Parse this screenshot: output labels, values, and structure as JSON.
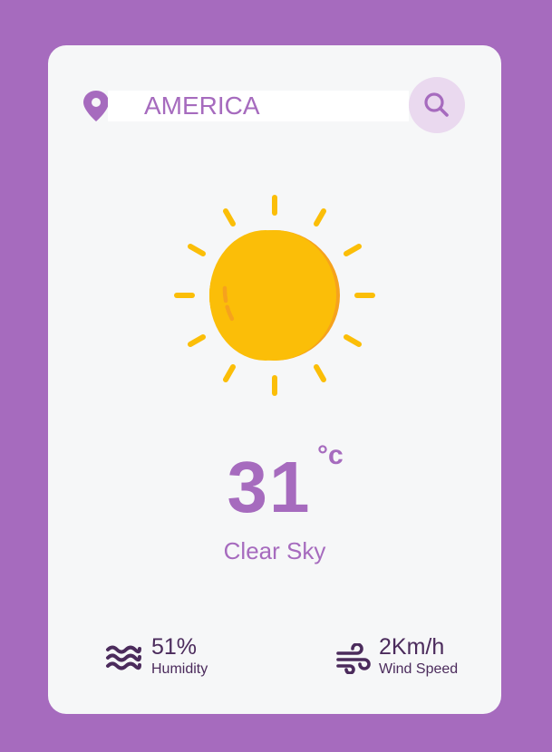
{
  "search": {
    "value": "AMERICA",
    "placeholder": "",
    "location_icon": "map-pin-icon",
    "button_icon": "search-icon"
  },
  "weather": {
    "icon": "sun-icon",
    "temperature": "31",
    "unit": "°c",
    "condition": "Clear Sky"
  },
  "stats": {
    "humidity": {
      "icon": "waves-icon",
      "value": "51%",
      "label": "Humidity"
    },
    "wind": {
      "icon": "wind-icon",
      "value": "2Km/h",
      "label": "Wind Speed"
    }
  },
  "colors": {
    "background": "#a66bbe",
    "card": "#f6f7f8",
    "accent": "#a66bbe",
    "search_button_bg": "#ead9ef",
    "sun_yellow": "#fbbe08",
    "sun_orange": "#f6a21d",
    "stat_text": "#4b2b5c"
  }
}
